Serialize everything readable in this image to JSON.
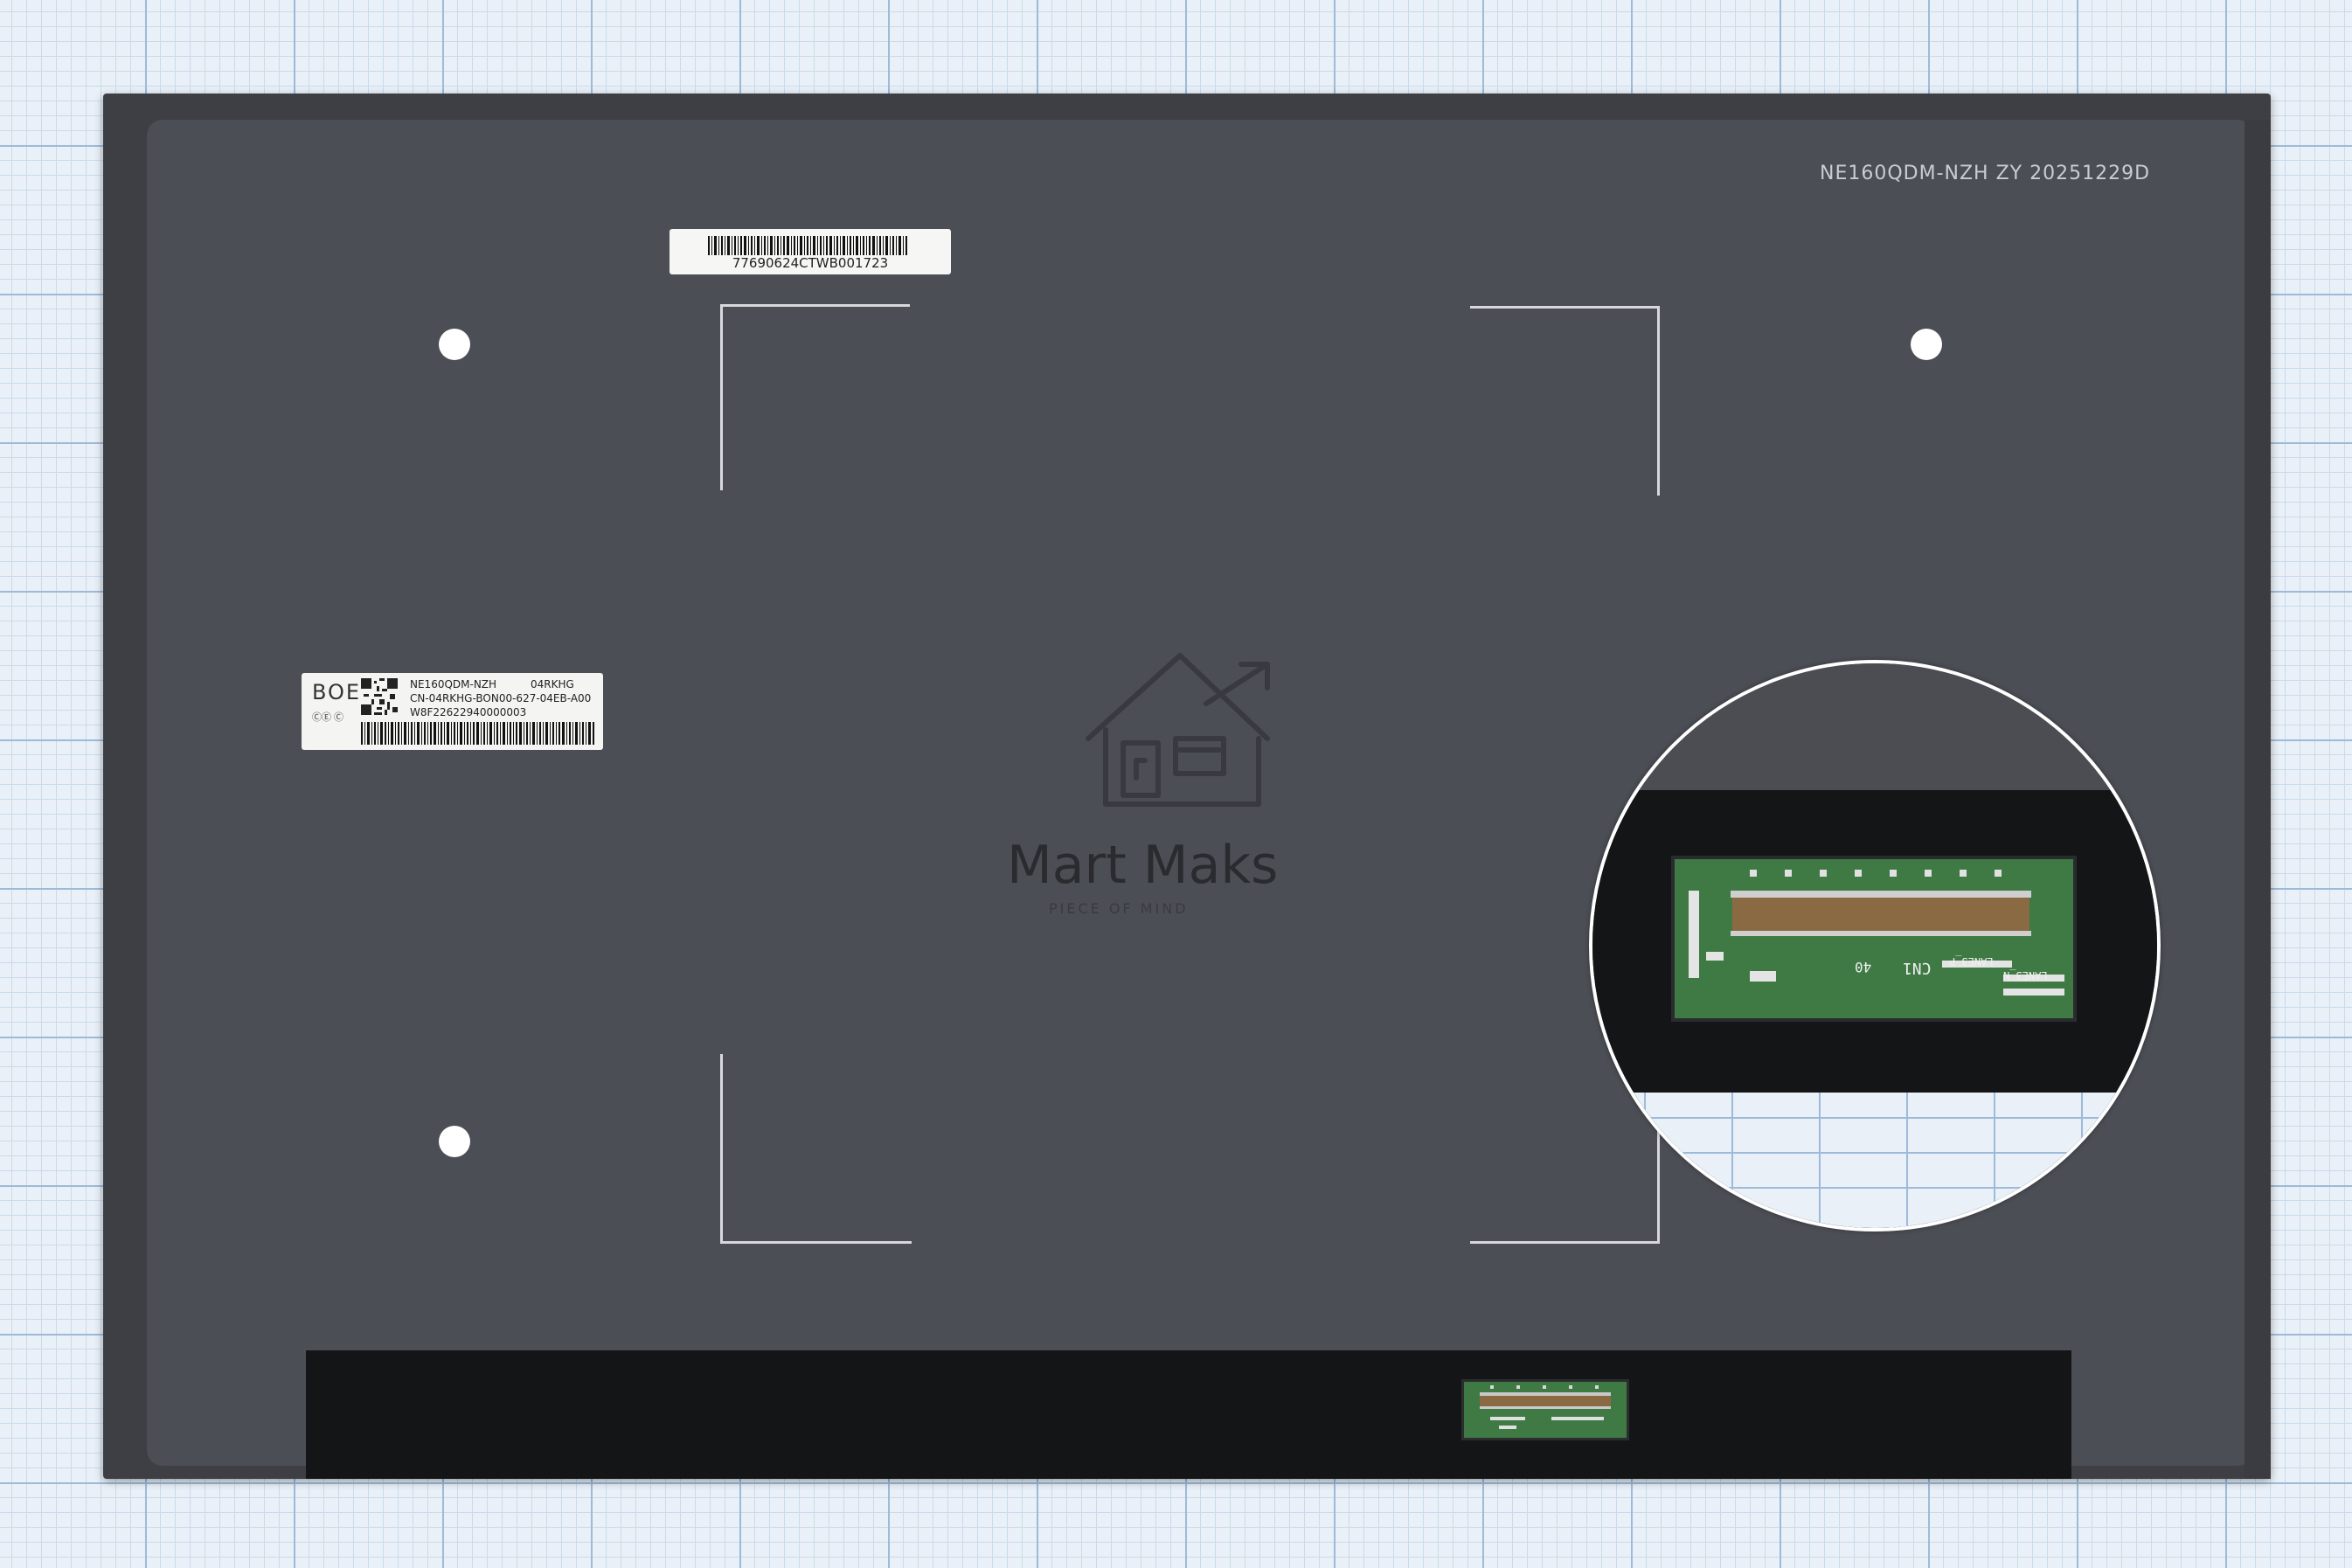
{
  "product": {
    "panel_marking": "NE160QDM-NZH  ZY  20251229D",
    "barcode_label": "77690624CTWB001723",
    "boe_label": {
      "brand": "BOE",
      "cert": "ⒸⒺ Ⓒ",
      "line1_model": "NE160QDM-NZH",
      "line1_code": "04RKHG",
      "line2": "CN-04RKHG-BON00-627-04EB-A00",
      "line3": "W8F22622940000003"
    },
    "connector_labels": [
      "CN1",
      "40",
      "LANE3_P",
      "LANE3_N"
    ]
  },
  "watermark": {
    "name": "Mart Maks",
    "tagline": "PIECE OF MIND",
    "icon": "house-arrow-logo-icon"
  },
  "colors": {
    "panel": "#4c4e55",
    "bottom_strip": "#141516",
    "pcb": "#3f7a45",
    "grid": "#9dbbd9"
  }
}
